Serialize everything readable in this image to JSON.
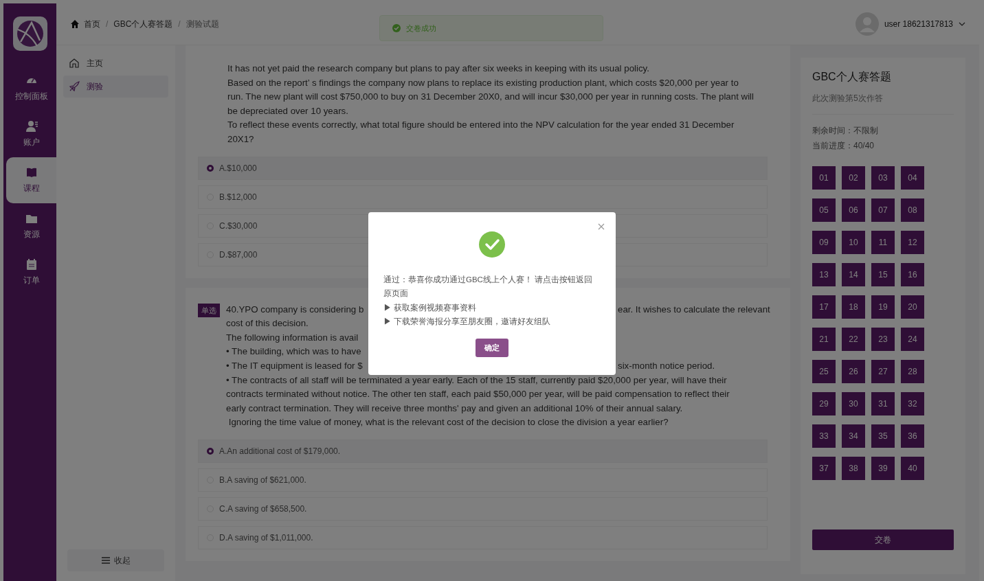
{
  "sidebar": {
    "items": [
      {
        "label": "控制面板",
        "selected": false
      },
      {
        "label": "账户",
        "selected": false
      },
      {
        "label": "课程",
        "selected": true
      },
      {
        "label": "资源",
        "selected": false
      },
      {
        "label": "订单",
        "selected": false
      }
    ]
  },
  "breadcrumb": [
    {
      "kind": "link",
      "text": "首页"
    },
    {
      "kind": "separator",
      "text": "/"
    },
    {
      "kind": "link",
      "text": "GBC个人赛答题"
    },
    {
      "kind": "separator",
      "text": "/"
    },
    {
      "kind": "current",
      "text": "测验试题"
    }
  ],
  "toast": {
    "text": "交卷成功"
  },
  "user": {
    "name": "user 18621317813"
  },
  "subnav": {
    "items": [
      {
        "label": "主页",
        "selected": false
      },
      {
        "label": "测验",
        "selected": true
      }
    ],
    "collapse": "收起"
  },
  "questions": [
    {
      "lines": [
        [
          "It has not yet paid the research company but plans to pay after six weeks in keeping with its usual policy."
        ],
        [
          "Based on the report’ s findings the company now plans to replace its existing production plant, which costs $20,000 per year to"
        ],
        [
          "run. The new plant will cost $750,000 to buy on 31 December 20X0, and will incur $30,000 per year in running costs. The plant will"
        ],
        [
          "be depreciated over 10 years."
        ],
        [
          "To reflect these events correctly, what total figure should be entered into the NPV calculation for the year ended 31 December"
        ],
        [
          "20X1?"
        ]
      ],
      "options": [
        {
          "label": "A.$10,000",
          "selected": true
        },
        {
          "label": "B.$12,000",
          "selected": false
        },
        {
          "label": "C.$30,000",
          "selected": false
        },
        {
          "label": "D.$87,000",
          "selected": false
        }
      ]
    },
    {
      "badge": "单选",
      "lines": [
        [
          "40.YPO company is considering b",
          "ear. It wishes to calculate the relevant"
        ],
        [
          "cost of this decision."
        ],
        [
          "The following information is avail"
        ],
        [
          "• The building, which was to have"
        ],
        [
          "• The IT equipment is leased for $",
          "six-month notice period."
        ],
        [
          "• The contracts of all staff will be terminated a year early. Each of the 15 staff, currently paid $20,000 per year, will have their"
        ],
        [
          "contracts terminated without notice. The other ten staff, each paid $50,000 per year, will be paid compensation to reflect their"
        ],
        [
          "early contract termination. They will receive three months' pay and given an additional 10% of their annual salary."
        ],
        [
          " Ignoring the time value of money, what is the relevant cost of the decision to close the division a year earlier?"
        ]
      ],
      "options": [
        {
          "label": "A.An additional cost of $179,000.",
          "selected": true
        },
        {
          "label": "B.A saving of $621,000.",
          "selected": false
        },
        {
          "label": "C.A saving of $658,500.",
          "selected": false
        },
        {
          "label": "D.A saving of $1,011,000.",
          "selected": false
        }
      ]
    }
  ],
  "panel": {
    "title": "GBC个人赛答题",
    "subtitle": "此次测验第5次作答",
    "remaining": "剩余时间：不限制",
    "progress": "当前进度：40/40",
    "numbers": [
      "01",
      "02",
      "03",
      "04",
      "05",
      "06",
      "07",
      "08",
      "09",
      "10",
      "11",
      "12",
      "13",
      "14",
      "15",
      "16",
      "17",
      "18",
      "19",
      "20",
      "21",
      "22",
      "23",
      "24",
      "25",
      "26",
      "27",
      "28",
      "29",
      "30",
      "31",
      "32",
      "33",
      "34",
      "35",
      "36",
      "37",
      "38",
      "39",
      "40"
    ],
    "submit": "交卷"
  },
  "modal": {
    "message": "通过：恭喜你成功通过GBC线上个人赛！ 请点击按钮返回原页面",
    "bullets": [
      "▶ 获取案例视频赛事资料",
      "▶ 下载荣誉海报分享至朋友圈，邀请好友组队"
    ],
    "confirm": "确定"
  }
}
